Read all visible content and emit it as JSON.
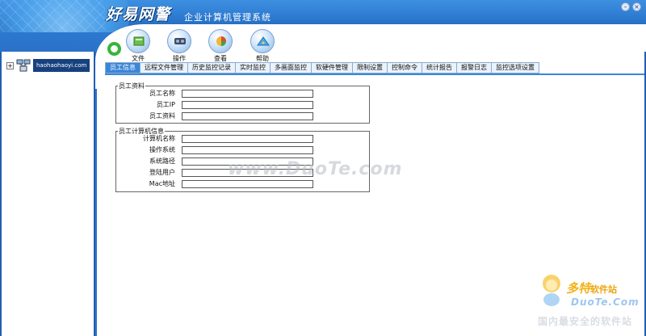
{
  "window": {
    "brand": "好易网警",
    "subtitle": "企业计算机管理系统",
    "controls": [
      "–",
      "×"
    ]
  },
  "toolbar": {
    "buttons": [
      {
        "label": "文件",
        "icon": "file-icon"
      },
      {
        "label": "操作",
        "icon": "operation-icon"
      },
      {
        "label": "查看",
        "icon": "view-icon"
      },
      {
        "label": "帮助",
        "icon": "help-icon"
      }
    ]
  },
  "tree": {
    "expander": "+",
    "root_label": "haohaohaoyi.com"
  },
  "tabs": [
    {
      "label": "员工信息",
      "active": true
    },
    {
      "label": "远程文件管理",
      "active": false
    },
    {
      "label": "历史监控记录",
      "active": false
    },
    {
      "label": "实时监控",
      "active": false
    },
    {
      "label": "多画面监控",
      "active": false
    },
    {
      "label": "软硬件管理",
      "active": false
    },
    {
      "label": "限制设置",
      "active": false
    },
    {
      "label": "控制命令",
      "active": false
    },
    {
      "label": "统计报告",
      "active": false
    },
    {
      "label": "报警日志",
      "active": false
    },
    {
      "label": "监控选项设置",
      "active": false
    }
  ],
  "employee_group": {
    "legend": "员工资料",
    "fields": [
      {
        "label": "员工名称",
        "value": ""
      },
      {
        "label": "员工IP",
        "value": ""
      },
      {
        "label": "员工资料",
        "value": ""
      }
    ]
  },
  "computer_group": {
    "legend": "员工计算机信息",
    "fields": [
      {
        "label": "计算机名称",
        "value": ""
      },
      {
        "label": "操作系统",
        "value": ""
      },
      {
        "label": "系统路径",
        "value": ""
      },
      {
        "label": "登陆用户",
        "value": ""
      },
      {
        "label": "Mac地址",
        "value": ""
      }
    ]
  },
  "watermark": {
    "center": "www.DuoTe.com",
    "site_cn": "多特",
    "site_cn_suffix": "软件站",
    "site_en": "DuoTe.Com",
    "slogan": "国内最安全的软件站"
  },
  "colors": {
    "header_blue": "#2f7ed3",
    "active_tab": "#3a86d8",
    "tab_bg": "#eaf2fb",
    "orb_green": "#36b53a",
    "watermark_gold": "#f2b31a"
  }
}
